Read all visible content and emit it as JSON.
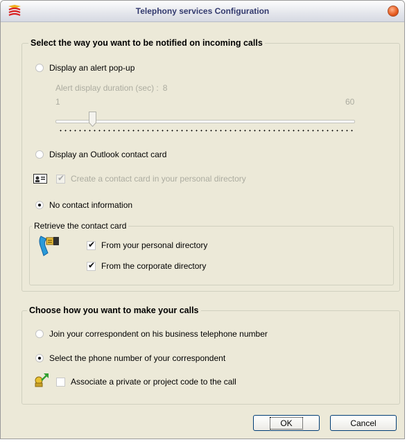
{
  "window": {
    "title": "Telephony services Configuration"
  },
  "notify": {
    "title": "Select the way you want to be notified on incoming calls",
    "options": [
      {
        "label": "Display an alert pop-up",
        "selected": false
      },
      {
        "label": "Display an Outlook contact card",
        "selected": false
      },
      {
        "label": "No contact information",
        "selected": true
      }
    ],
    "alert_duration": {
      "label": "Alert display duration (sec) :",
      "value": "8",
      "min": "1",
      "max": "60",
      "enabled": false
    },
    "create_card": {
      "label": "Create a contact card in your personal directory",
      "checked": true,
      "enabled": false
    },
    "retrieve": {
      "title": "Retrieve the contact card",
      "items": [
        {
          "label": "From your personal directory",
          "checked": true
        },
        {
          "label": "From the corporate directory",
          "checked": true
        }
      ]
    }
  },
  "calls": {
    "title": "Choose how you want to make your calls",
    "options": [
      {
        "label": "Join your correspondent on his business telephone number",
        "selected": false
      },
      {
        "label": "Select the phone number of your correspondent",
        "selected": true
      }
    ],
    "associate": {
      "label": "Associate a private or project code to the call",
      "checked": false
    }
  },
  "buttons": {
    "ok": "OK",
    "cancel": "Cancel"
  },
  "icons": {
    "app": "phone-app-icon",
    "close": "close-icon",
    "contact_card": "contact-card-icon",
    "directory": "phone-directory-icon",
    "project_code": "project-code-icon"
  },
  "colors": {
    "face": "#ece9d8",
    "title_text": "#333a6e",
    "close": "#e65a1e",
    "disabled_text": "#acaca0",
    "button_border": "#003c74"
  }
}
